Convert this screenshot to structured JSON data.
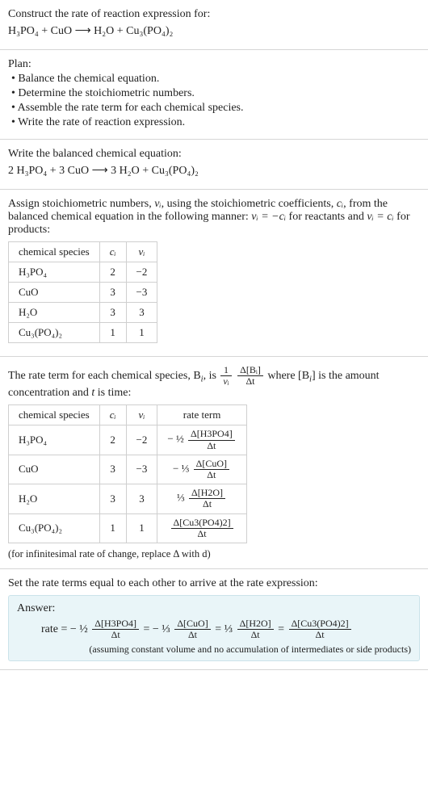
{
  "s1": {
    "prompt": "Construct the rate of reaction expression for:",
    "equation": "H₃PO₄ + CuO ⟶ H₂O + Cu₃(PO₄)₂"
  },
  "s2": {
    "title": "Plan:",
    "b1": "• Balance the chemical equation.",
    "b2": "• Determine the stoichiometric numbers.",
    "b3": "• Assemble the rate term for each chemical species.",
    "b4": "• Write the rate of reaction expression."
  },
  "s3": {
    "title": "Write the balanced chemical equation:",
    "equation": "2 H₃PO₄ + 3 CuO ⟶ 3 H₂O + Cu₃(PO₄)₂"
  },
  "s4": {
    "intro_a": "Assign stoichiometric numbers, ",
    "nu_i": "νᵢ",
    "intro_b": ", using the stoichiometric coefficients, ",
    "c_i": "cᵢ",
    "intro_c": ", from the balanced chemical equation in the following manner: ",
    "rel_react": "νᵢ = −cᵢ",
    "intro_d": " for reactants and ",
    "rel_prod": "νᵢ = cᵢ",
    "intro_e": " for products:",
    "headers": {
      "species": "chemical species",
      "ci": "cᵢ",
      "vi": "νᵢ"
    },
    "rows": [
      {
        "species": "H₃PO₄",
        "ci": "2",
        "vi": "−2"
      },
      {
        "species": "CuO",
        "ci": "3",
        "vi": "−3"
      },
      {
        "species": "H₂O",
        "ci": "3",
        "vi": "3"
      },
      {
        "species": "Cu₃(PO₄)₂",
        "ci": "1",
        "vi": "1"
      }
    ]
  },
  "s5": {
    "lead_a": "The rate term for each chemical species, B",
    "lead_b": ", is ",
    "frac1_num": "1",
    "frac1_den": "νᵢ",
    "frac2_num": "Δ[Bᵢ]",
    "frac2_den": "Δt",
    "lead_c": " where [B",
    "lead_d": "] is the amount concentration and ",
    "t": "t",
    "lead_e": " is time:",
    "headers": {
      "species": "chemical species",
      "ci": "cᵢ",
      "vi": "νᵢ",
      "rate": "rate term"
    },
    "rows": [
      {
        "species": "H₃PO₄",
        "ci": "2",
        "vi": "−2",
        "coef": "− ½",
        "d_num": "Δ[H3PO4]",
        "d_den": "Δt"
      },
      {
        "species": "CuO",
        "ci": "3",
        "vi": "−3",
        "coef": "− ⅓",
        "d_num": "Δ[CuO]",
        "d_den": "Δt"
      },
      {
        "species": "H₂O",
        "ci": "3",
        "vi": "3",
        "coef": "⅓",
        "d_num": "Δ[H2O]",
        "d_den": "Δt"
      },
      {
        "species": "Cu₃(PO₄)₂",
        "ci": "1",
        "vi": "1",
        "coef": "",
        "d_num": "Δ[Cu3(PO4)2]",
        "d_den": "Δt"
      }
    ],
    "note": "(for infinitesimal rate of change, replace Δ with d)"
  },
  "s6": {
    "title": "Set the rate terms equal to each other to arrive at the rate expression:",
    "answer_label": "Answer:",
    "rate_word": "rate = ",
    "t1_coef": "− ½",
    "t1_num": "Δ[H3PO4]",
    "t1_den": "Δt",
    "eq": " = ",
    "t2_coef": "− ⅓",
    "t2_num": "Δ[CuO]",
    "t2_den": "Δt",
    "t3_coef": "⅓",
    "t3_num": "Δ[H2O]",
    "t3_den": "Δt",
    "t4_num": "Δ[Cu3(PO4)2]",
    "t4_den": "Δt",
    "assume": "(assuming constant volume and no accumulation of intermediates or side products)"
  }
}
